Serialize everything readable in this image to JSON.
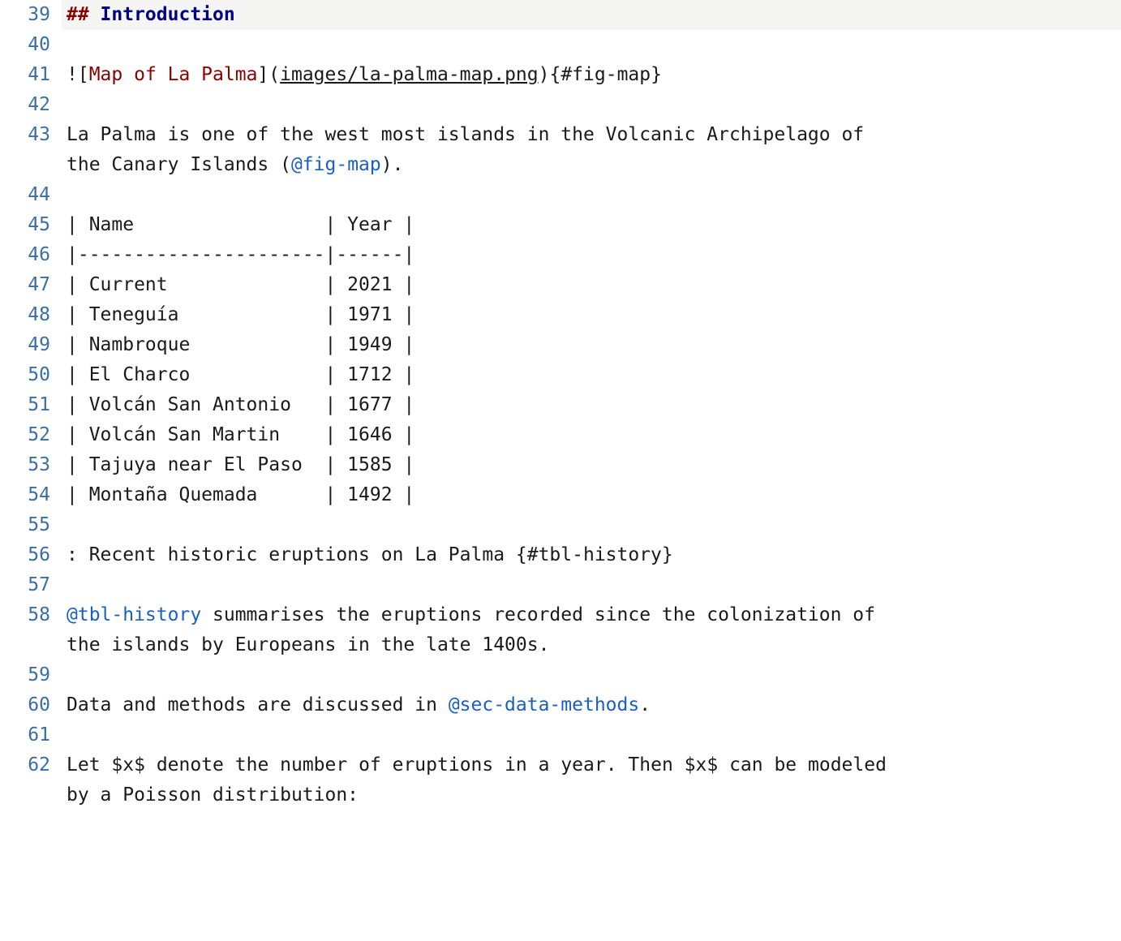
{
  "editor": {
    "lines": [
      {
        "n": 39,
        "kind": "heading",
        "mark": "##",
        "text": "Introduction"
      },
      {
        "n": 40,
        "kind": "blank"
      },
      {
        "n": 41,
        "kind": "image",
        "bang": "!",
        "lb": "[",
        "alt": "Map of La Palma",
        "rb": "]",
        "lp": "(",
        "href": "images/la-palma-map.png",
        "rp": ")",
        "attr": "{#fig-map}"
      },
      {
        "n": 42,
        "kind": "blank"
      },
      {
        "n": 43,
        "kind": "para_xref",
        "pre": "La Palma is one of the west most islands in the Volcanic Archipelago of the Canary Islands (",
        "xref": "@fig-map",
        "post": ")."
      },
      {
        "n": 44,
        "kind": "blank"
      },
      {
        "n": 45,
        "kind": "raw",
        "text": "| Name                 | Year |"
      },
      {
        "n": 46,
        "kind": "raw",
        "text": "|----------------------|------|"
      },
      {
        "n": 47,
        "kind": "raw",
        "text": "| Current              | 2021 |"
      },
      {
        "n": 48,
        "kind": "raw",
        "text": "| Teneguía             | 1971 |"
      },
      {
        "n": 49,
        "kind": "raw",
        "text": "| Nambroque            | 1949 |"
      },
      {
        "n": 50,
        "kind": "raw",
        "text": "| El Charco            | 1712 |"
      },
      {
        "n": 51,
        "kind": "raw",
        "text": "| Volcán San Antonio   | 1677 |"
      },
      {
        "n": 52,
        "kind": "raw",
        "text": "| Volcán San Martin    | 1646 |"
      },
      {
        "n": 53,
        "kind": "raw",
        "text": "| Tajuya near El Paso  | 1585 |"
      },
      {
        "n": 54,
        "kind": "raw",
        "text": "| Montaña Quemada      | 1492 |"
      },
      {
        "n": 55,
        "kind": "blank"
      },
      {
        "n": 56,
        "kind": "raw",
        "text": ": Recent historic eruptions on La Palma {#tbl-history}"
      },
      {
        "n": 57,
        "kind": "blank"
      },
      {
        "n": 58,
        "kind": "para_xref_lead",
        "xref": "@tbl-history",
        "post": " summarises the eruptions recorded since the colonization of the islands by Europeans in the late 1400s."
      },
      {
        "n": 59,
        "kind": "blank"
      },
      {
        "n": 60,
        "kind": "para_xref_mid",
        "pre": "Data and methods are discussed in ",
        "xref": "@sec-data-methods",
        "post": "."
      },
      {
        "n": 61,
        "kind": "blank"
      },
      {
        "n": 62,
        "kind": "para_math",
        "p1": "Let ",
        "d1": "$",
        "v1": "x",
        "d1c": "$",
        "p2": " denote the number of eruptions in a year. Then ",
        "d2": "$",
        "v2": "x",
        "d2c": "$",
        "p3": " can be modeled by a Poisson distribution:"
      }
    ]
  }
}
